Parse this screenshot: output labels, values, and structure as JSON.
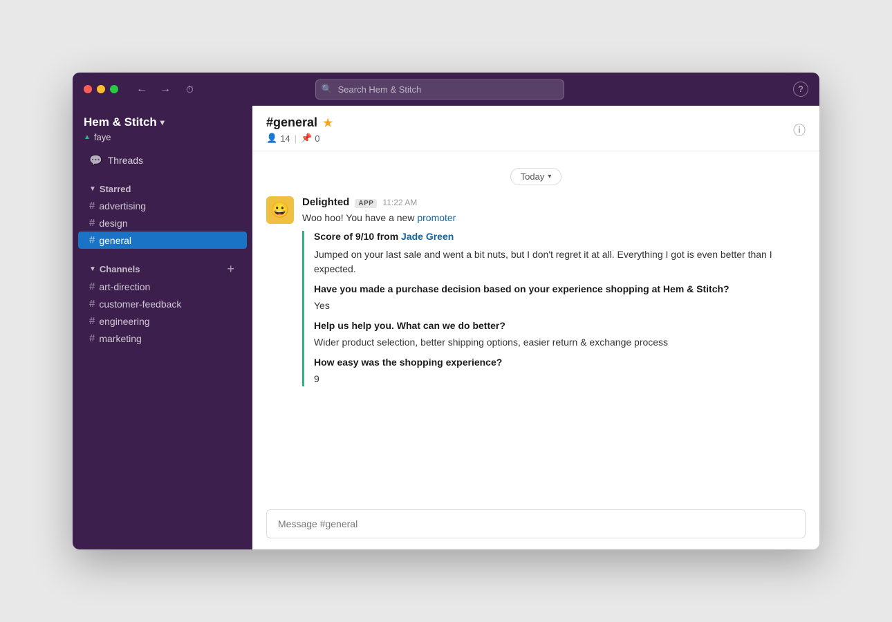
{
  "window": {
    "title": "Hem & Stitch"
  },
  "titlebar": {
    "back_label": "←",
    "forward_label": "→",
    "history_label": "⏱",
    "search_placeholder": "Search Hem & Stitch",
    "help_label": "?"
  },
  "sidebar": {
    "workspace_name": "Hem & Stitch",
    "workspace_chevron": "▾",
    "user_name": "faye",
    "threads_label": "Threads",
    "starred_label": "Starred",
    "starred_triangle": "▼",
    "starred_channels": [
      {
        "name": "advertising"
      },
      {
        "name": "design"
      },
      {
        "name": "general"
      }
    ],
    "channels_label": "Channels",
    "channels_triangle": "▼",
    "channels_add": "+",
    "channels": [
      {
        "name": "art-direction"
      },
      {
        "name": "customer-feedback"
      },
      {
        "name": "engineering"
      },
      {
        "name": "marketing"
      }
    ]
  },
  "channel": {
    "name": "#general",
    "star": "★",
    "members_count": "14",
    "pins_count": "0",
    "members_icon": "👤",
    "pins_icon": "📌",
    "separator": "|"
  },
  "date_divider": {
    "label": "Today",
    "chevron": "▾"
  },
  "message": {
    "sender": "Delighted",
    "app_badge": "APP",
    "timestamp": "11:22 AM",
    "text_before_link": "Woo hoo! You have a new ",
    "link_text": "promoter",
    "card": {
      "score_label": "Score of 9/10 from ",
      "score_name": "Jade Green",
      "body_text": "Jumped on your last sale and went a bit nuts, but I don't regret it at all. Everything I got is even better than I expected.",
      "q1": "Have you made a purchase decision based on your experience shopping at Hem & Stitch?",
      "a1": "Yes",
      "q2": "Help us help you. What can we do better?",
      "a2": "Wider product selection, better shipping options, easier return & exchange process",
      "q3": "How easy was the shopping experience?",
      "a3": "9"
    }
  },
  "message_input": {
    "placeholder": "Message #general"
  }
}
